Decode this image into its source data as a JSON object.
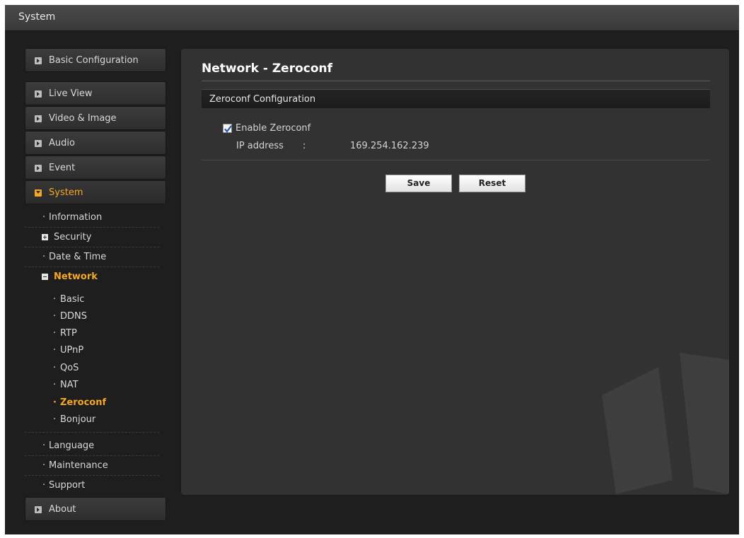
{
  "window": {
    "title": "System"
  },
  "sidebar": {
    "basic_configuration": "Basic Configuration",
    "items": [
      {
        "label": "Live View"
      },
      {
        "label": "Video & Image"
      },
      {
        "label": "Audio"
      },
      {
        "label": "Event"
      },
      {
        "label": "System"
      }
    ],
    "system_sub": [
      {
        "label": "Information"
      },
      {
        "label": "Security"
      },
      {
        "label": "Date & Time"
      },
      {
        "label": "Network"
      }
    ],
    "network_sub": [
      {
        "label": "Basic"
      },
      {
        "label": "DDNS"
      },
      {
        "label": "RTP"
      },
      {
        "label": "UPnP"
      },
      {
        "label": "QoS"
      },
      {
        "label": "NAT"
      },
      {
        "label": "Zeroconf"
      },
      {
        "label": "Bonjour"
      }
    ],
    "system_sub_after": [
      {
        "label": "Language"
      },
      {
        "label": "Maintenance"
      },
      {
        "label": "Support"
      }
    ],
    "about": "About",
    "bullet": "·"
  },
  "main": {
    "page_title": "Network - Zeroconf",
    "section_title": "Zeroconf Configuration",
    "enable_label": "Enable Zeroconf",
    "enable_checked": true,
    "ip_label": "IP address",
    "ip_colon": ":",
    "ip_value": "169.254.162.239",
    "save_label": "Save",
    "reset_label": "Reset"
  },
  "colors": {
    "accent": "#f3a826",
    "panel_bg": "#323232",
    "page_bg": "#1e1e1e"
  },
  "icons": {
    "nav_arrow": "right-arrow-box-icon",
    "nav_open": "down-arrow-box-icon",
    "expand": "plus-box-icon",
    "collapse": "minus-box-icon",
    "checkbox": "checkmark-icon"
  }
}
